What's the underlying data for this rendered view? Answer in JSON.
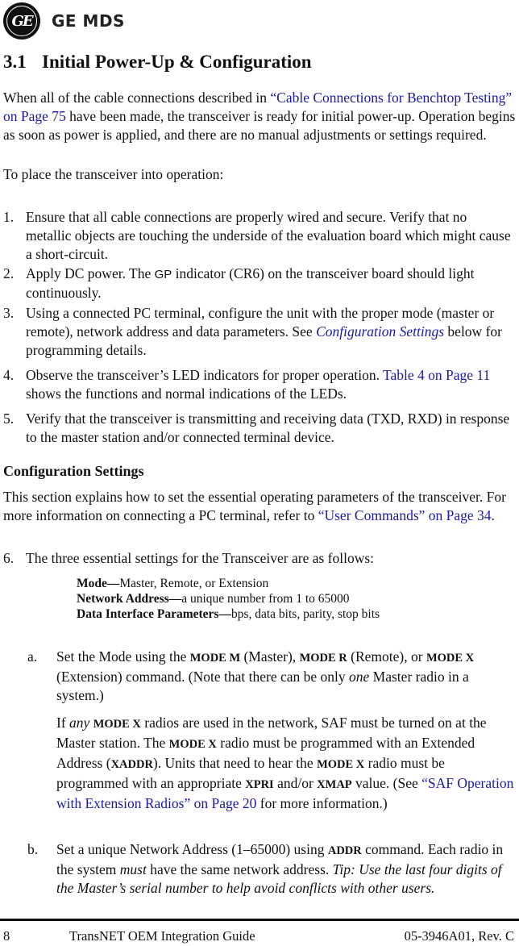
{
  "header": {
    "logo_monogram": "GE",
    "brand": "GE MDS"
  },
  "section": {
    "number": "3.1",
    "title": "Initial Power-Up & Configuration"
  },
  "intro": {
    "pre": "When all of the cable connections described in ",
    "link": "“Cable Connections for Benchtop Testing” on Page 75",
    "post": " have been made, the transceiver is ready for initial power-up. Operation begins as soon as power is applied, and there are no manual adjustments or settings required."
  },
  "lead_in": "To place the transceiver into operation:",
  "steps": [
    {
      "num": "1.",
      "text": "Ensure that all cable connections are properly wired and secure. Verify that no metallic objects are touching the underside of the evaluation board which might cause a short-circuit."
    },
    {
      "num": "2.",
      "pre": "Apply DC power. The ",
      "gp": "GP",
      "post": " indicator (CR6) on the transceiver board should light continuously."
    },
    {
      "num": "3.",
      "pre": "Using a connected PC terminal, configure the unit with the proper mode (master or remote), network address and data parameters. See ",
      "link": "Configuration Settings",
      "post": " below for programming details."
    },
    {
      "num": "4.",
      "pre": "Observe the transceiver’s LED indicators for proper operation. ",
      "link": "Table 4 on Page 11",
      "post": " shows the functions and normal indications of the LEDs."
    },
    {
      "num": "5.",
      "text": "Verify that the transceiver is transmitting and receiving data (TXD, RXD) in response to the master station and/or connected terminal device."
    }
  ],
  "config": {
    "heading": "Configuration Settings",
    "para_pre": "This section explains how to set the essential operating parameters of the transceiver. For more information on connecting a PC terminal, refer to ",
    "para_link": "“User Commands” on Page 34",
    "para_post": ".",
    "step6_num": "6.",
    "step6_text": "The three essential settings for the Transceiver are as follows:",
    "settings": [
      {
        "label": "Mode",
        "sep": "—",
        "value": "Master, Remote, or Extension"
      },
      {
        "label": "Network Address",
        "sep": "—",
        "value": "a unique number from 1 to 65000"
      },
      {
        "label": "Data Interface Parameters",
        "sep": "—",
        "value": "bps, data bits, parity, stop bits"
      }
    ]
  },
  "substeps": {
    "a": {
      "marker": "a.",
      "t1": "Set the Mode using the ",
      "c1": "MODE M",
      "t2": " (Master), ",
      "c2": "MODE R",
      "t3": " (Remote), or ",
      "c3": "MODE X",
      "t4": " (Extension) command. (Note that there can be only ",
      "em1": "one",
      "t5": " Master radio in a system.)",
      "p2_t1": "If ",
      "p2_em": "any",
      "p2_c1": "MODE X",
      "p2_t2": " radios are used in the network, SAF must be turned on at the Master station. The ",
      "p2_c2": "MODE X",
      "p2_t3": " radio must be programmed with an Extended Address (",
      "p2_c3": "XADDR",
      "p2_t4": "). Units that need to hear the ",
      "p2_c4": "MODE X",
      "p2_t5": " radio must be programmed with an appropriate ",
      "p2_c5": "XPRI",
      "p2_t6": " and/or ",
      "p2_c6": "XMAP",
      "p2_t7": " value. (See ",
      "p2_link": "“SAF Operation with Extension Radios” on Page 20",
      "p2_t8": " for more information.)"
    },
    "b": {
      "marker": "b.",
      "t1": "Set a unique Network Address (1–65000) using ",
      "c1": "ADDR",
      "t2": " command. Each radio in the system ",
      "em1": "must",
      "t3": " have the same network address. ",
      "tip": "Tip: Use the last four digits of the Master’s serial number to help avoid conflicts with other users."
    }
  },
  "footer": {
    "page": "8",
    "title": "TransNET OEM Integration Guide",
    "doc_id": "05-3946A01, Rev. C"
  },
  "colors": {
    "link": "#1a1aa6",
    "text": "#111111"
  }
}
